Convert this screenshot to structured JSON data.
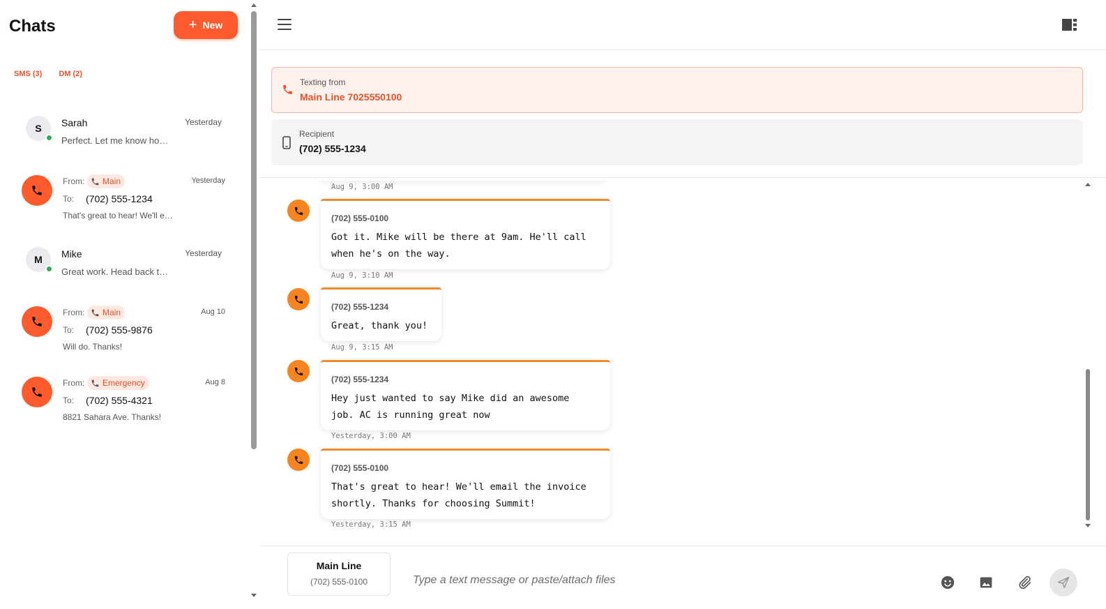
{
  "sidebar": {
    "title": "Chats",
    "new_button": "New",
    "tabs": [
      "SMS (3)",
      "DM (2)"
    ],
    "chats": [
      {
        "type": "dm",
        "initial": "S",
        "name": "Sarah",
        "time": "Yesterday",
        "preview": "Perfect. Let me know how the job goes",
        "online": true
      },
      {
        "type": "sms",
        "from_label": "From:",
        "from_chip": "Main",
        "to_label": "To:",
        "to": "(702) 555-1234",
        "time": "Yesterday",
        "preview": "That's great to hear! We'll email the invoice"
      },
      {
        "type": "dm",
        "initial": "M",
        "name": "Mike",
        "time": "Yesterday",
        "preview": "Great work. Head back to the shop",
        "online": true
      },
      {
        "type": "sms",
        "from_label": "From:",
        "from_chip": "Main",
        "to_label": "To:",
        "to": "(702) 555-9876",
        "time": "Aug 10",
        "preview": "Will do. Thanks!"
      },
      {
        "type": "sms",
        "from_label": "From:",
        "from_chip": "Emergency",
        "to_label": "To:",
        "to": "(702) 555-4321",
        "time": "Aug 8",
        "preview": "8821 Sahara Ave. Thanks!"
      }
    ]
  },
  "header": {
    "menu_icon": "hamburger-menu-icon",
    "panel_icon": "panel-toggle-icon"
  },
  "texting_from": {
    "label": "Texting from",
    "value": "Main Line 7025550100"
  },
  "recipient": {
    "label": "Recipient",
    "value": "(702) 555-1234"
  },
  "messages": {
    "top_timestamp": "Aug 9, 3:00 AM",
    "items": [
      {
        "sender": "(702) 555-0100",
        "text": "Got it. Mike will be there at 9am. He'll call\nwhen he's on the way.",
        "timestamp": "Aug 9, 3:10 AM"
      },
      {
        "sender": "(702) 555-1234",
        "text": "Great, thank you!",
        "timestamp": "Aug 9, 3:15 AM"
      },
      {
        "sender": "(702) 555-1234",
        "text": "Hey just wanted to say Mike did an awesome\njob. AC is running great now",
        "timestamp": "Yesterday, 3:00 AM"
      },
      {
        "sender": "(702) 555-0100",
        "text": "That's great to hear! We'll email the invoice\nshortly. Thanks for choosing Summit!",
        "timestamp": "Yesterday, 3:15 AM"
      }
    ]
  },
  "composer": {
    "line_name": "Main Line",
    "line_number": "(702) 555-0100",
    "placeholder": "Type a text message or paste/attach files",
    "tools": [
      "emoji-icon",
      "image-icon",
      "attach-icon",
      "send-icon"
    ]
  },
  "colors": {
    "accent": "#ff5b2e",
    "message_accent": "#f08a2e",
    "online": "#34a853"
  }
}
